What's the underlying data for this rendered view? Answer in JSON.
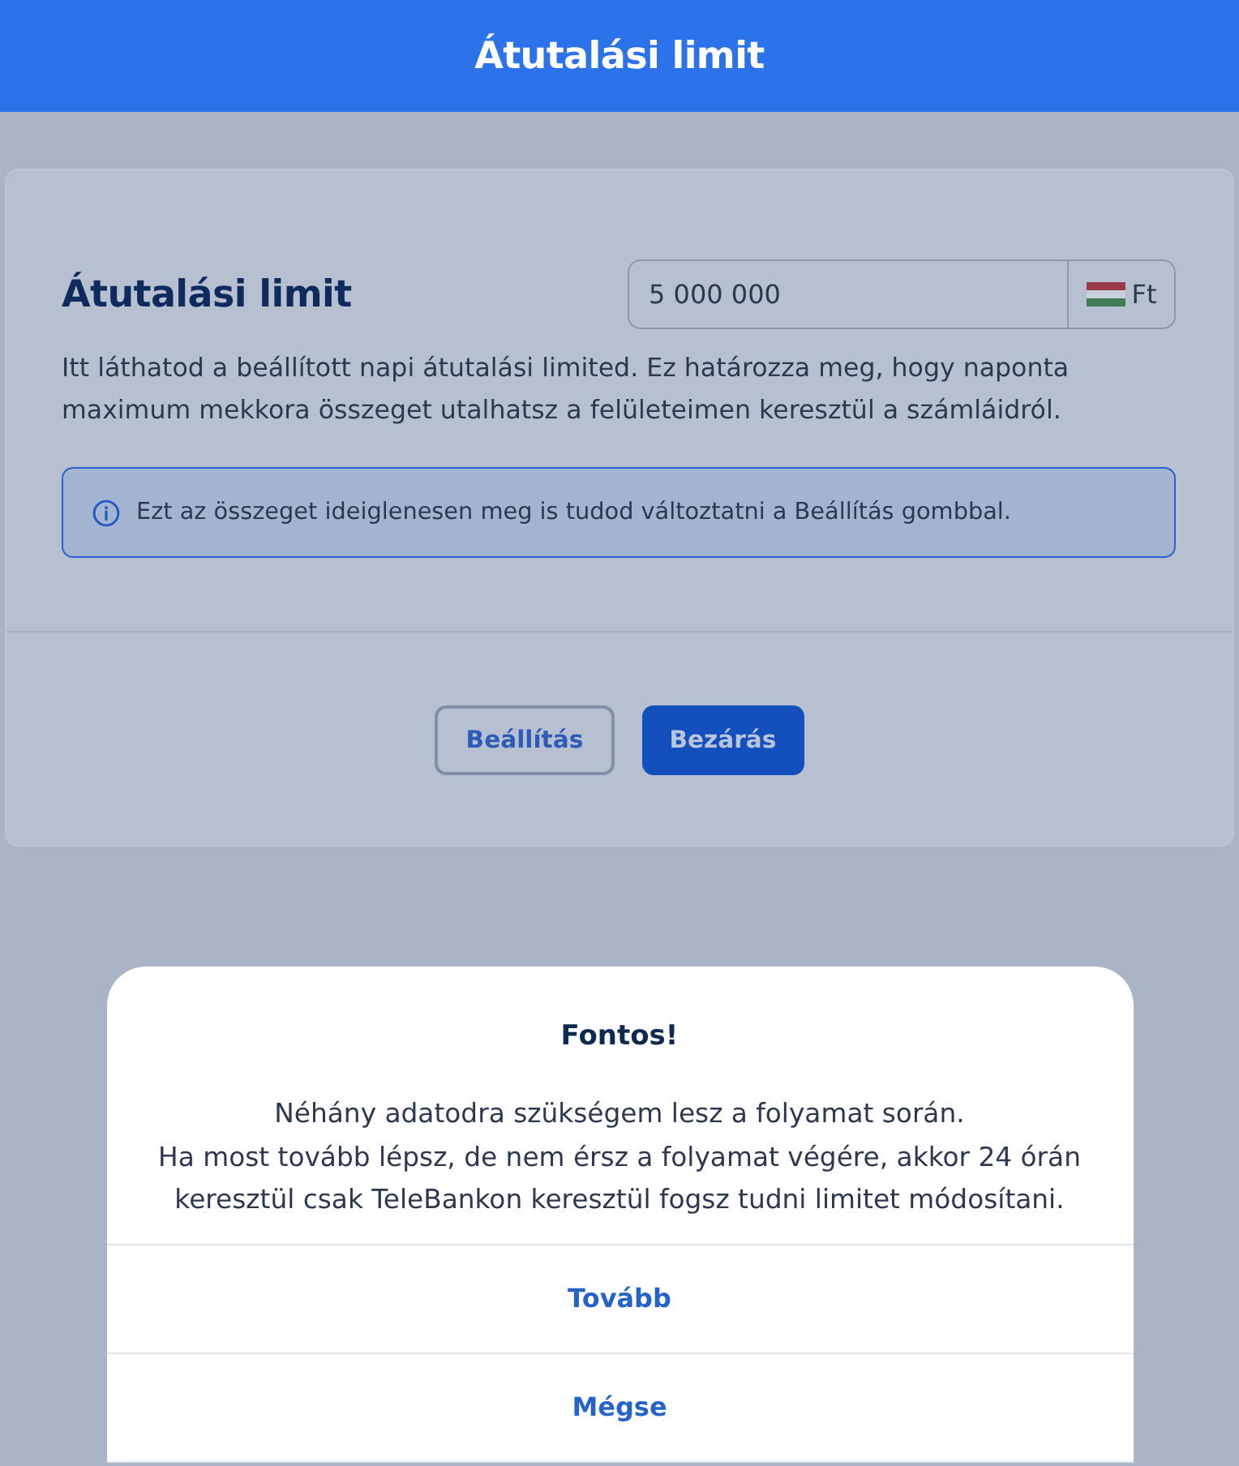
{
  "header": {
    "title": "Átutalási limit"
  },
  "limit_card": {
    "title": "Átutalási limit",
    "amount": {
      "value": "5 000 000",
      "currency": "Ft"
    },
    "description": "Itt láthatod a beállított napi átutalási limited. Ez határozza meg, hogy naponta maximum mekkora összeget utalhatsz a felületeimen keresztül a számláidról.",
    "info": "Ezt az összeget ideiglenesen meg is tudod változtatni a Beállítás gombbal.",
    "buttons": [
      {
        "label": "Beállítás",
        "kind": "secondary"
      },
      {
        "label": "Bezárás",
        "kind": "primary"
      }
    ]
  },
  "dialog": {
    "title": "Fontos!",
    "message": [
      "Néhány adatodra szükségem lesz a folyamat során.",
      "Ha most tovább lépsz, de nem érsz a folyamat végére, akkor 24 órán keresztül csak TeleBankon keresztül fogsz tudni limitet módosítani."
    ],
    "actions": [
      "Tovább",
      "Mégse"
    ]
  }
}
